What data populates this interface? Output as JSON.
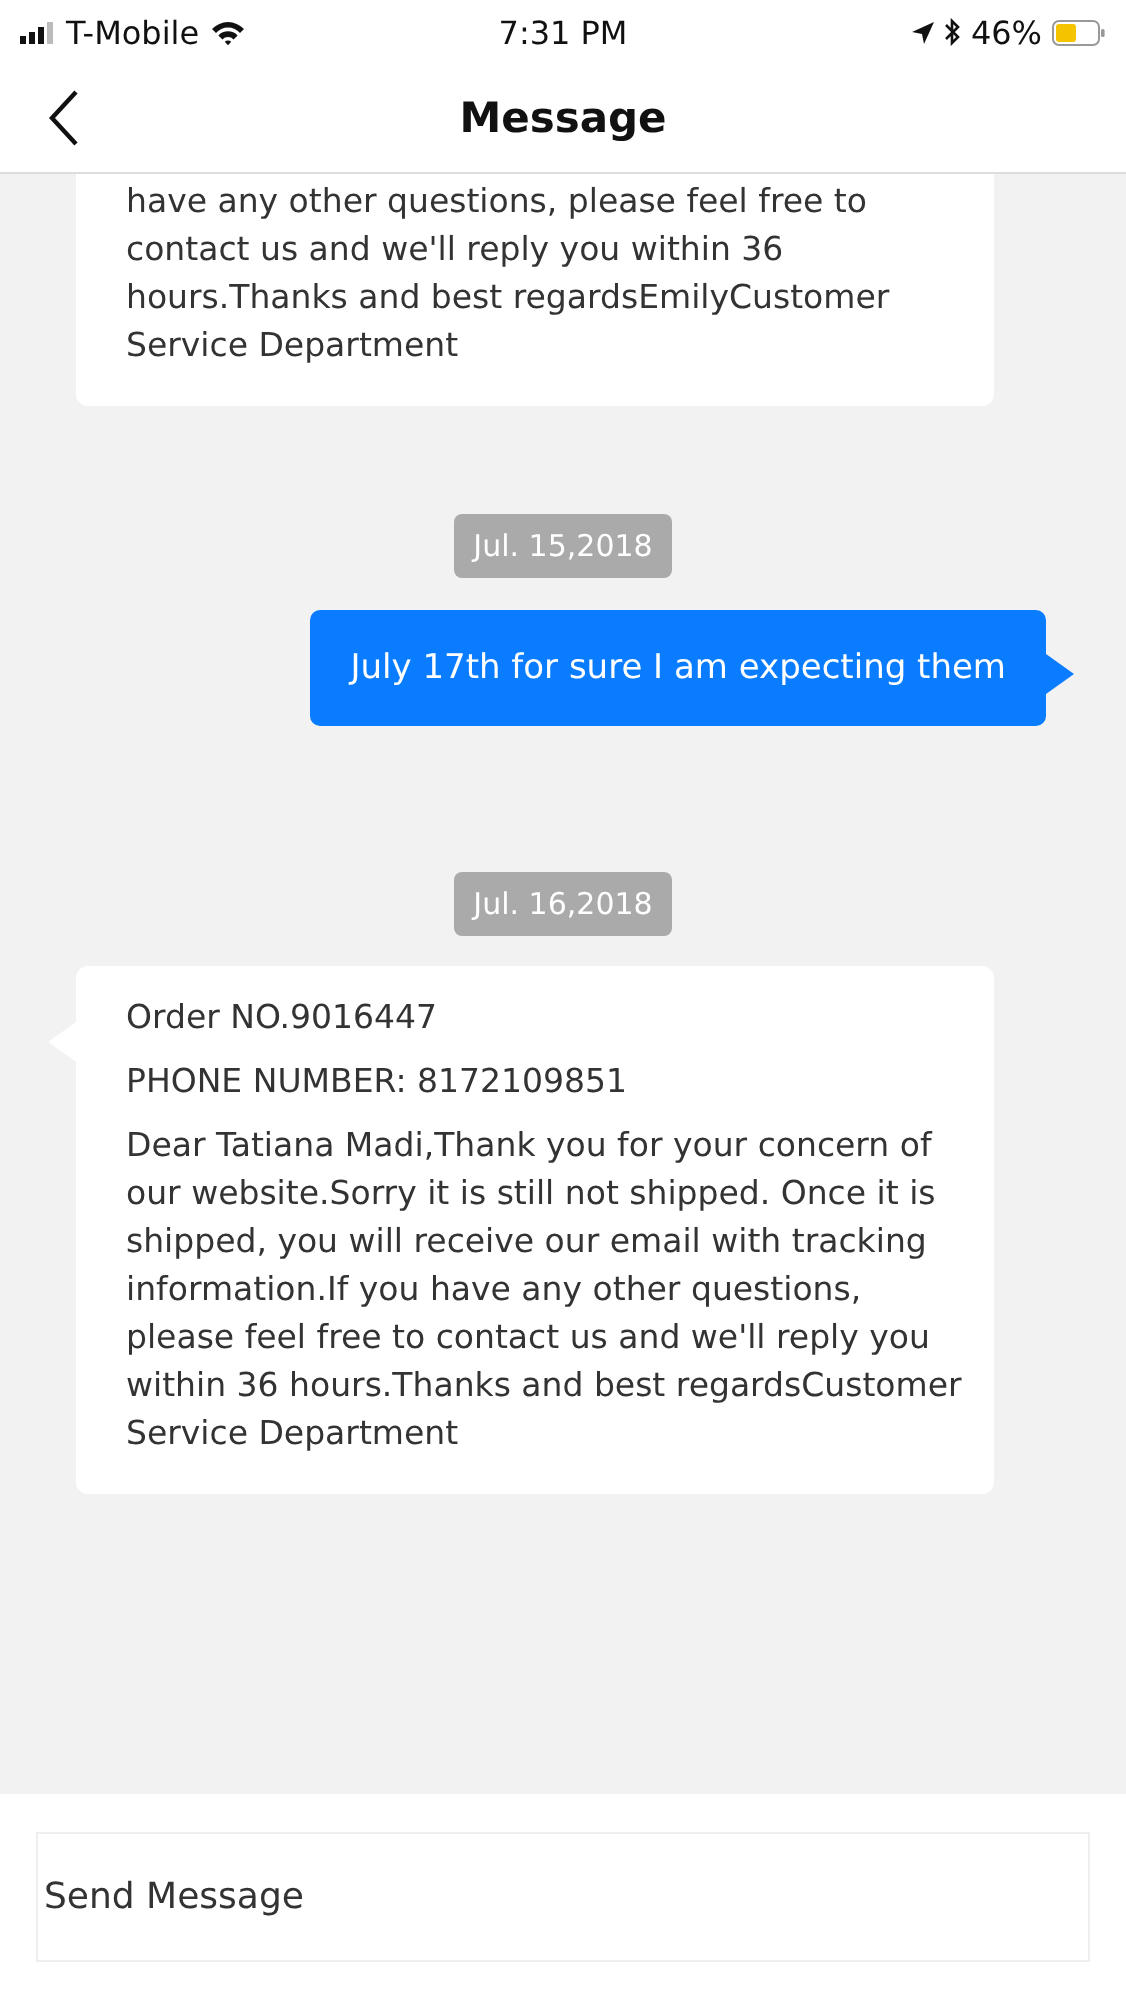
{
  "status_bar": {
    "carrier": "T-Mobile",
    "time": "7:31 PM",
    "battery": "46%"
  },
  "header": {
    "title": "Message"
  },
  "messages": [
    {
      "kind": "incoming",
      "tail": false,
      "paragraphs": [
        "have any other questions, please feel free to contact us and we'll reply you within 36 hours.Thanks and best regardsEmilyCustomer Service Department"
      ]
    },
    {
      "kind": "date",
      "text": "Jul. 15,2018"
    },
    {
      "kind": "outgoing",
      "paragraphs": [
        "July 17th for sure I am expecting them"
      ]
    },
    {
      "kind": "date",
      "text": "Jul. 16,2018"
    },
    {
      "kind": "incoming",
      "tail": true,
      "paragraphs": [
        "Order NO.9016447",
        "PHONE NUMBER: 8172109851",
        "Dear Tatiana Madi,Thank you for your concern of our website.Sorry it is still not shipped. Once it is shipped, you will receive our email with tracking information.If you have any other questions, please feel free to contact us and we'll reply you within 36 hours.Thanks and best regardsCustomer Service Department"
      ]
    }
  ],
  "composer": {
    "placeholder": "Send Message"
  }
}
